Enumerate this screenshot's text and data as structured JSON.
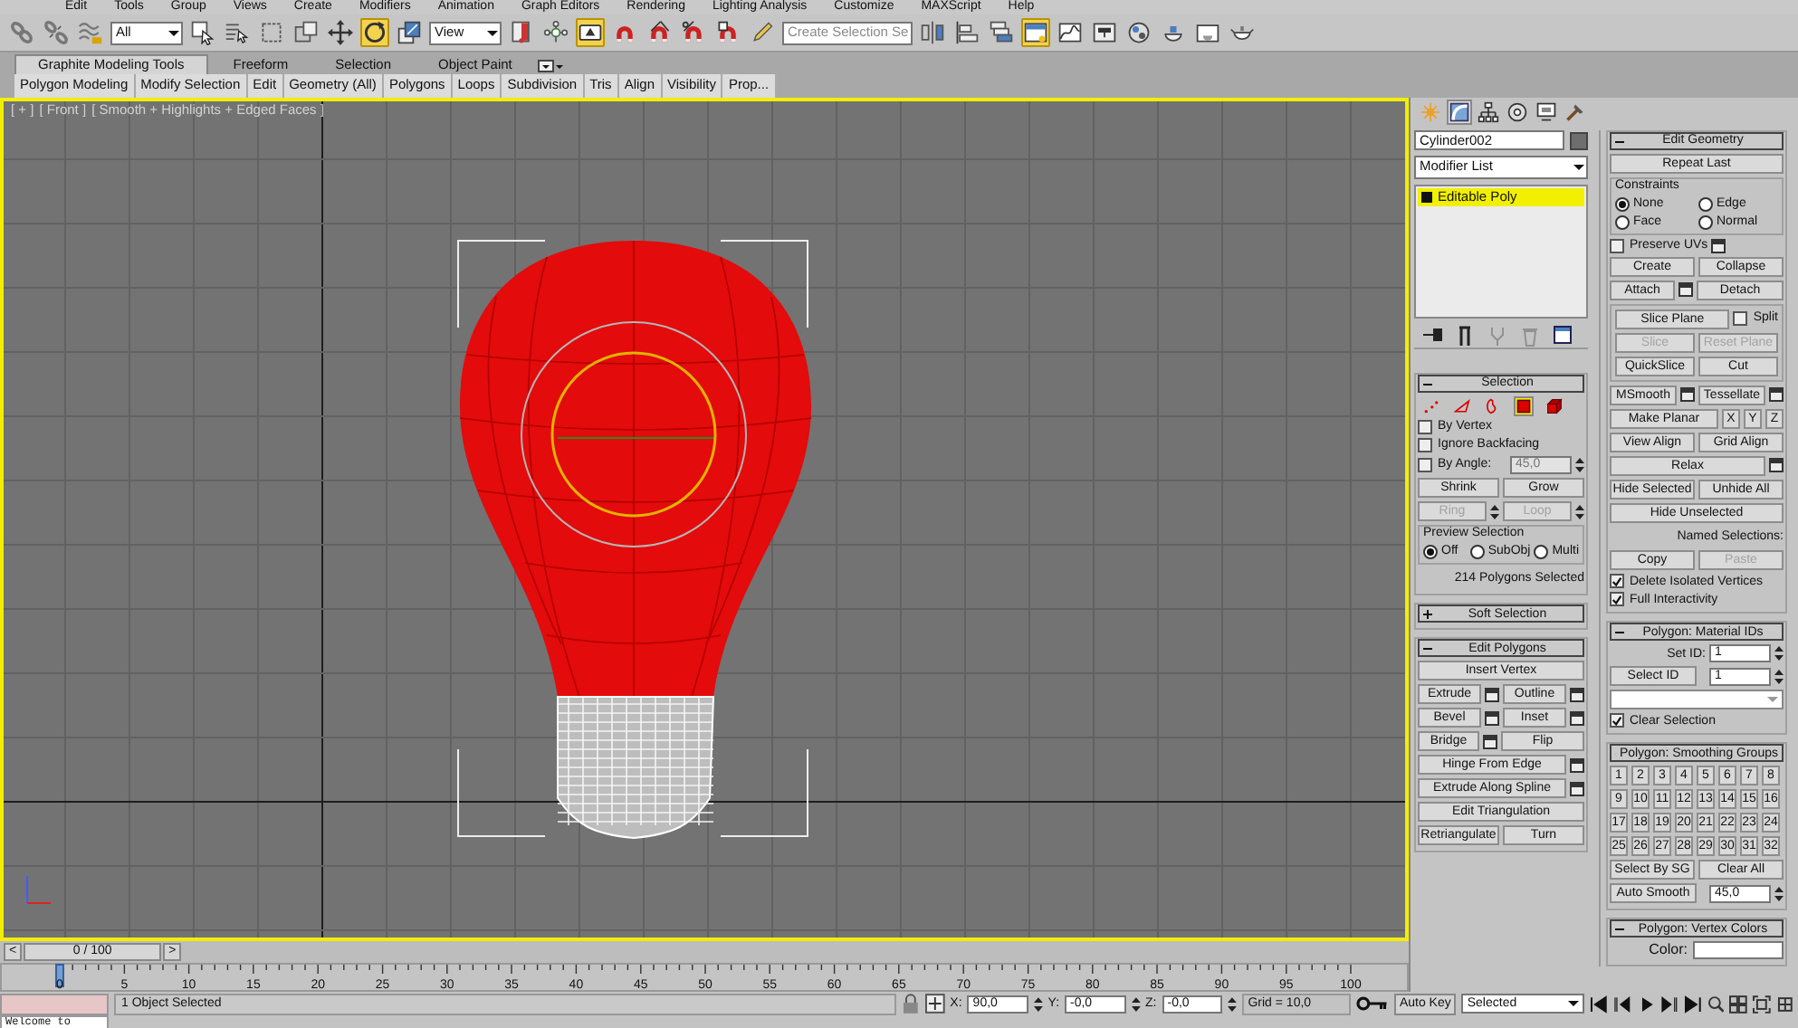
{
  "menu": [
    "Edit",
    "Tools",
    "Group",
    "Views",
    "Create",
    "Modifiers",
    "Animation",
    "Graph Editors",
    "Rendering",
    "Lighting Analysis",
    "Customize",
    "MAXScript",
    "Help"
  ],
  "toolbar": [
    {
      "kind": "link",
      "active": false
    },
    {
      "kind": "unlink",
      "active": false
    },
    {
      "kind": "bind",
      "active": false
    },
    {
      "kind": "dropdown",
      "value": "All"
    },
    {
      "kind": "select",
      "active": false
    },
    {
      "kind": "select_by_name",
      "active": false
    },
    {
      "kind": "region",
      "active": false
    },
    {
      "kind": "crossing",
      "active": false
    },
    {
      "kind": "move",
      "active": false
    },
    {
      "kind": "rotate",
      "active": true
    },
    {
      "kind": "scale",
      "active": false
    },
    {
      "kind": "dropdown",
      "value": "View"
    },
    {
      "kind": "pivot",
      "active": false
    },
    {
      "kind": "manipulate",
      "active": false
    },
    {
      "kind": "override",
      "active": true
    },
    {
      "kind": "snap",
      "active": false
    },
    {
      "kind": "angle_snap",
      "active": false
    },
    {
      "kind": "percent_snap",
      "active": false
    },
    {
      "kind": "spinner_snap",
      "active": false
    },
    {
      "kind": "named_sets",
      "active": false
    },
    {
      "kind": "combo",
      "placeholder": "Create Selection Se"
    },
    {
      "kind": "mirror",
      "active": false
    },
    {
      "kind": "align",
      "active": false
    },
    {
      "kind": "layers",
      "active": false
    },
    {
      "kind": "ribbon",
      "active": true
    },
    {
      "kind": "curve_editor",
      "active": false
    },
    {
      "kind": "schematic",
      "active": false
    },
    {
      "kind": "material",
      "active": false
    },
    {
      "kind": "render_setup",
      "active": false
    },
    {
      "kind": "frame_window",
      "active": false
    },
    {
      "kind": "render",
      "active": false
    }
  ],
  "ribbon": {
    "tabs": [
      {
        "label": "Graphite Modeling Tools",
        "selected": true
      },
      {
        "label": "Freeform",
        "selected": false
      },
      {
        "label": "Selection",
        "selected": false
      },
      {
        "label": "Object Paint",
        "selected": false
      }
    ],
    "panels": [
      "Polygon Modeling",
      "Modify Selection",
      "Edit",
      "Geometry (All)",
      "Polygons",
      "Loops",
      "Subdivision",
      "Tris",
      "Align",
      "Visibility",
      "Prop..."
    ]
  },
  "viewport": {
    "labels": [
      "[ + ]",
      "[ Front ]",
      "[ Smooth + Highlights + Edged Faces ]"
    ]
  },
  "time_slider": {
    "previous": "<",
    "position": "0 / 100",
    "next": ">"
  },
  "track_bar": {
    "frame_labels": [
      "0",
      "5",
      "10",
      "15",
      "20",
      "25",
      "30",
      "35",
      "40",
      "45",
      "50",
      "55",
      "60",
      "65",
      "70",
      "75",
      "80",
      "85",
      "90",
      "95",
      "100"
    ]
  },
  "command_panel": {
    "tabs": [
      {
        "kind": "create",
        "selected": false
      },
      {
        "kind": "modify",
        "selected": true
      },
      {
        "kind": "hierarchy",
        "selected": false
      },
      {
        "kind": "motion",
        "selected": false
      },
      {
        "kind": "display",
        "selected": false
      },
      {
        "kind": "utilities",
        "selected": false
      }
    ],
    "object_name": "Cylinder002",
    "modifier_list": "Modifier List",
    "stack": [
      {
        "label": "Editable Poly",
        "selected": true
      }
    ],
    "stack_tools": [
      {
        "kind": "pin"
      },
      {
        "kind": "end_result"
      },
      {
        "kind": "make_unique",
        "disabled": true
      },
      {
        "kind": "remove",
        "disabled": true
      },
      {
        "kind": "configure"
      }
    ],
    "left_rollouts": [
      {
        "title": "Selection",
        "expanded": true,
        "rows": [
          [
            {
              "kind": "vertex_level",
              "selected": false
            },
            {
              "kind": "edge_level",
              "selected": false
            },
            {
              "kind": "border_level",
              "selected": false
            },
            {
              "kind": "polygon_level",
              "selected": true
            },
            {
              "kind": "element_level",
              "selected": false
            }
          ],
          [
            {
              "kind": "checkbox",
              "label": "By Vertex",
              "checked": false
            }
          ],
          [
            {
              "kind": "checkbox",
              "label": "Ignore Backfacing",
              "checked": false
            }
          ],
          [
            {
              "kind": "checkbox",
              "label": "By Angle:",
              "checked": false
            },
            {
              "kind": "spinner",
              "value": "45,0",
              "disabled": true
            }
          ],
          [
            {
              "kind": "button",
              "label": "Shrink"
            },
            {
              "kind": "button",
              "label": "Grow"
            }
          ],
          [
            {
              "kind": "button",
              "label": "Ring",
              "disabled": true,
              "stepper": true
            },
            {
              "kind": "button",
              "label": "Loop",
              "disabled": true,
              "stepper": true
            }
          ],
          [
            {
              "kind": "group",
              "title": "Preview Selection",
              "rows": [
                [
                  {
                    "kind": "radio",
                    "label": "Off",
                    "selected": true
                  },
                  {
                    "kind": "radio",
                    "label": "SubObj",
                    "selected": false
                  },
                  {
                    "kind": "radio",
                    "label": "Multi",
                    "selected": false
                  }
                ]
              ]
            }
          ],
          [
            {
              "kind": "text",
              "text": "214 Polygons Selected"
            }
          ]
        ]
      },
      {
        "title": "Soft Selection",
        "expanded": false
      },
      {
        "title": "Edit Polygons",
        "expanded": true,
        "rows": [
          [
            {
              "kind": "button",
              "label": "Insert Vertex"
            }
          ],
          [
            {
              "kind": "button",
              "label": "Extrude",
              "settings": true
            },
            {
              "kind": "button",
              "label": "Outline",
              "settings": true
            }
          ],
          [
            {
              "kind": "button",
              "label": "Bevel",
              "settings": true
            },
            {
              "kind": "button",
              "label": "Inset",
              "settings": true
            }
          ],
          [
            {
              "kind": "button",
              "label": "Bridge",
              "settings": true
            },
            {
              "kind": "button",
              "label": "Flip"
            }
          ],
          [
            {
              "kind": "button",
              "label": "Hinge From Edge",
              "settings": true
            }
          ],
          [
            {
              "kind": "button",
              "label": "Extrude Along Spline",
              "settings": true
            }
          ],
          [
            {
              "kind": "button",
              "label": "Edit Triangulation"
            }
          ],
          [
            {
              "kind": "button",
              "label": "Retriangulate"
            },
            {
              "kind": "button",
              "label": "Turn"
            }
          ]
        ]
      }
    ],
    "right_rollouts": [
      {
        "title": "Edit Geometry",
        "expanded": true,
        "rows": [
          [
            {
              "kind": "button",
              "label": "Repeat Last"
            }
          ],
          [
            {
              "kind": "group",
              "title": "Constraints",
              "rows": [
                [
                  {
                    "kind": "radio",
                    "label": "None",
                    "selected": true
                  },
                  {
                    "kind": "radio",
                    "label": "Edge",
                    "selected": false
                  }
                ],
                [
                  {
                    "kind": "radio",
                    "label": "Face",
                    "selected": false
                  },
                  {
                    "kind": "radio",
                    "label": "Normal",
                    "selected": false
                  }
                ]
              ]
            }
          ],
          [
            {
              "kind": "checkbox",
              "label": "Preserve UVs",
              "checked": false,
              "settings": true
            }
          ],
          [
            {
              "kind": "button",
              "label": "Create"
            },
            {
              "kind": "button",
              "label": "Collapse"
            }
          ],
          [
            {
              "kind": "button",
              "label": "Attach",
              "settings": true
            },
            {
              "kind": "button",
              "label": "Detach"
            }
          ],
          [
            {
              "kind": "group",
              "rows": [
                [
                  {
                    "kind": "button",
                    "label": "Slice Plane"
                  },
                  {
                    "kind": "checkbox",
                    "label": "Split",
                    "checked": false
                  }
                ],
                [
                  {
                    "kind": "button",
                    "label": "Slice",
                    "disabled": true
                  },
                  {
                    "kind": "button",
                    "label": "Reset Plane",
                    "disabled": true
                  }
                ],
                [
                  {
                    "kind": "button",
                    "label": "QuickSlice"
                  },
                  {
                    "kind": "button",
                    "label": "Cut"
                  }
                ]
              ]
            }
          ],
          [
            {
              "kind": "button",
              "label": "MSmooth",
              "settings": true
            },
            {
              "kind": "button",
              "label": "Tessellate",
              "settings": true
            }
          ],
          [
            {
              "kind": "button",
              "label": "Make Planar"
            },
            {
              "kind": "tiny_button",
              "label": "X"
            },
            {
              "kind": "tiny_button",
              "label": "Y"
            },
            {
              "kind": "tiny_button",
              "label": "Z"
            }
          ],
          [
            {
              "kind": "button",
              "label": "View Align"
            },
            {
              "kind": "button",
              "label": "Grid Align"
            }
          ],
          [
            {
              "kind": "button",
              "label": "Relax",
              "settings": true
            }
          ],
          [
            {
              "kind": "button",
              "label": "Hide Selected"
            },
            {
              "kind": "button",
              "label": "Unhide All"
            }
          ],
          [
            {
              "kind": "button",
              "label": "Hide Unselected"
            }
          ],
          [
            {
              "kind": "text",
              "text": "Named Selections:"
            }
          ],
          [
            {
              "kind": "button",
              "label": "Copy"
            },
            {
              "kind": "button",
              "label": "Paste",
              "disabled": true
            }
          ],
          [
            {
              "kind": "checkbox",
              "label": "Delete Isolated Vertices",
              "checked": true
            }
          ],
          [
            {
              "kind": "checkbox",
              "label": "Full Interactivity",
              "checked": true
            }
          ]
        ]
      },
      {
        "title": "Polygon: Material IDs",
        "expanded": true,
        "rows": [
          [
            {
              "kind": "spinner",
              "label": "Set ID:",
              "value": "1"
            }
          ],
          [
            {
              "kind": "button",
              "label": "Select ID"
            },
            {
              "kind": "spinner",
              "value": "1"
            }
          ],
          [
            {
              "kind": "dropdown"
            }
          ],
          [
            {
              "kind": "checkbox",
              "label": "Clear Selection",
              "checked": true
            }
          ]
        ]
      },
      {
        "title": "Polygon: Smoothing Groups",
        "expanded": true,
        "rows": [
          [
            {
              "kind": "tiny_button",
              "label": "1"
            },
            {
              "kind": "tiny_button",
              "label": "2"
            },
            {
              "kind": "tiny_button",
              "label": "3"
            },
            {
              "kind": "tiny_button",
              "label": "4"
            },
            {
              "kind": "tiny_button",
              "label": "5"
            },
            {
              "kind": "tiny_button",
              "label": "6"
            },
            {
              "kind": "tiny_button",
              "label": "7"
            },
            {
              "kind": "tiny_button",
              "label": "8"
            }
          ],
          [
            {
              "kind": "tiny_button",
              "label": "9"
            },
            {
              "kind": "tiny_button",
              "label": "10"
            },
            {
              "kind": "tiny_button",
              "label": "11"
            },
            {
              "kind": "tiny_button",
              "label": "12"
            },
            {
              "kind": "tiny_button",
              "label": "13"
            },
            {
              "kind": "tiny_button",
              "label": "14"
            },
            {
              "kind": "tiny_button",
              "label": "15"
            },
            {
              "kind": "tiny_button",
              "label": "16"
            }
          ],
          [
            {
              "kind": "tiny_button",
              "label": "17"
            },
            {
              "kind": "tiny_button",
              "label": "18"
            },
            {
              "kind": "tiny_button",
              "label": "19"
            },
            {
              "kind": "tiny_button",
              "label": "20"
            },
            {
              "kind": "tiny_button",
              "label": "21"
            },
            {
              "kind": "tiny_button",
              "label": "22"
            },
            {
              "kind": "tiny_button",
              "label": "23"
            },
            {
              "kind": "tiny_button",
              "label": "24"
            }
          ],
          [
            {
              "kind": "tiny_button",
              "label": "25"
            },
            {
              "kind": "tiny_button",
              "label": "26"
            },
            {
              "kind": "tiny_button",
              "label": "27"
            },
            {
              "kind": "tiny_button",
              "label": "28"
            },
            {
              "kind": "tiny_button",
              "label": "29"
            },
            {
              "kind": "tiny_button",
              "label": "30"
            },
            {
              "kind": "tiny_button",
              "label": "31"
            },
            {
              "kind": "tiny_button",
              "label": "32"
            }
          ],
          [
            {
              "kind": "button",
              "label": "Select By SG"
            },
            {
              "kind": "button",
              "label": "Clear All"
            }
          ],
          [
            {
              "kind": "button",
              "label": "Auto Smooth"
            },
            {
              "kind": "spinner",
              "value": "45,0"
            }
          ]
        ]
      },
      {
        "title": "Polygon: Vertex Colors",
        "expanded": true,
        "rows": [
          [
            {
              "kind": "color_field",
              "label": "Color:"
            }
          ]
        ]
      }
    ]
  },
  "status_bar": {
    "selection_info": "1 Object Selected",
    "coordinates": [
      {
        "axis": "X:",
        "value": "90,0"
      },
      {
        "axis": "Y:",
        "value": "-0,0"
      },
      {
        "axis": "Z:",
        "value": "-0,0"
      }
    ],
    "grid": "Grid = 10,0",
    "auto_key": "Auto Key",
    "key_mode": "Selected",
    "prompt": "Welcome to"
  }
}
